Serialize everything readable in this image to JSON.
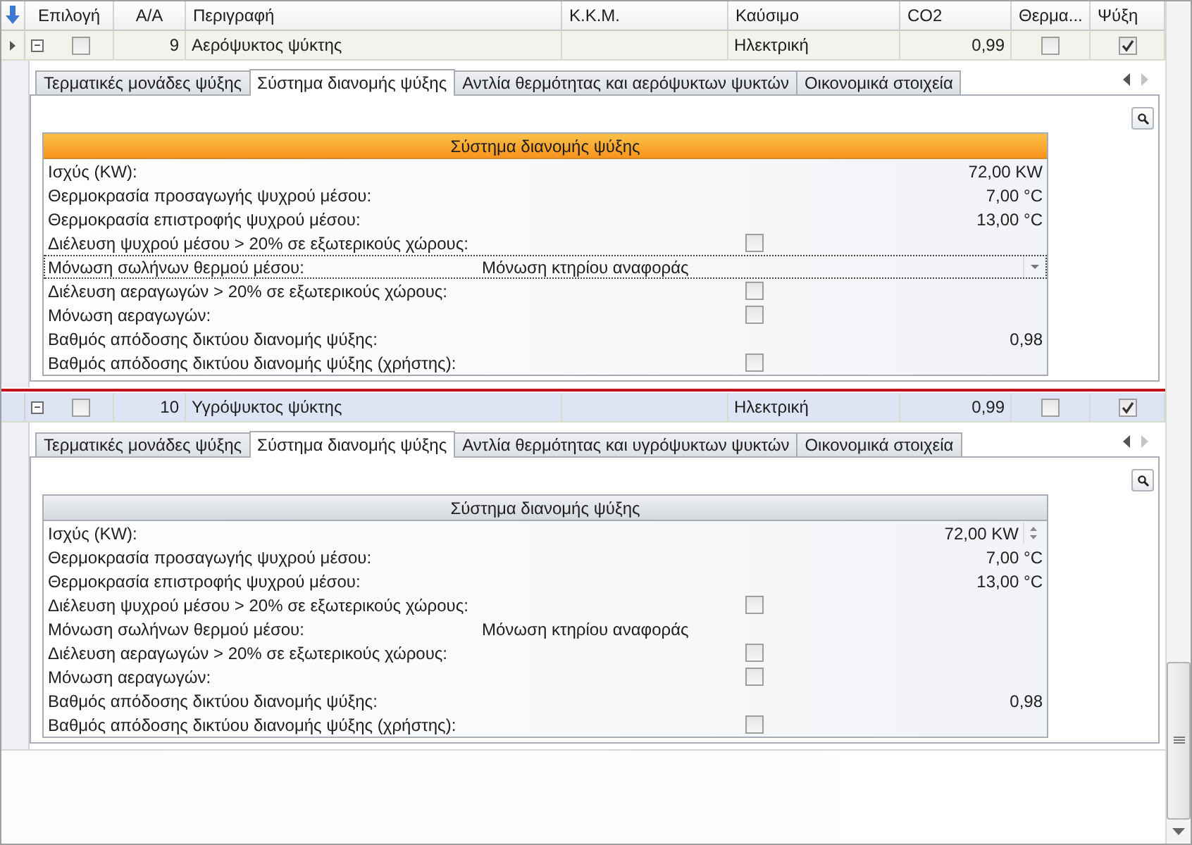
{
  "grid": {
    "columns": [
      "Επιλογή",
      "Α/Α",
      "Περιγραφή",
      "Κ.Κ.Μ.",
      "Καύσιμο",
      "CO2",
      "Θερμα...",
      "Ψύξη"
    ],
    "rows": [
      {
        "focused": true,
        "selected": false,
        "expanded": true,
        "checked": false,
        "number": "9",
        "description": "Αερόψυκτος ψύκτης",
        "fuel": "Ηλεκτρική",
        "co2": "0,99",
        "heating": false,
        "cooling": true,
        "detail": {
          "tabs": [
            {
              "label": "Τερματικές μονάδες ψύξης",
              "selected": false
            },
            {
              "label": "Σύστημα διανομής ψύξης",
              "selected": true
            },
            {
              "label": "Αντλία θερμότητας και αερόψυκτων ψυκτών",
              "selected": false
            },
            {
              "label": "Οικονομικά στοιχεία",
              "selected": false
            }
          ],
          "group": {
            "title": "Σύστημα διανομής ψύξης",
            "active": true
          },
          "fields": [
            {
              "label": "Ισχύς (KW):",
              "kind": "value",
              "value": "72,00 KW"
            },
            {
              "label": "Θερμοκρασία προσαγωγής ψυχρού μέσου:",
              "kind": "value",
              "value": "7,00 °C"
            },
            {
              "label": "Θερμοκρασία επιστροφής ψυχρού μέσου:",
              "kind": "value",
              "value": "13,00 °C"
            },
            {
              "label": "Διέλευση ψυχρού μέσου > 20% σε εξωτερικούς χώρους:",
              "kind": "checkbox",
              "checked": false
            },
            {
              "label": "Μόνωση σωλήνων θερμού μέσου:",
              "kind": "dropdown",
              "value": "Μόνωση κτηρίου αναφοράς"
            },
            {
              "label": "Διέλευση αεραγωγών > 20% σε εξωτερικούς χώρους:",
              "kind": "checkbox",
              "checked": false
            },
            {
              "label": "Μόνωση αεραγωγών:",
              "kind": "checkbox",
              "checked": false
            },
            {
              "label": "Βαθμός απόδοσης δικτύου διανομής ψύξης:",
              "kind": "value",
              "value": "0,98"
            },
            {
              "label": "Βαθμός απόδοσης δικτύου διανομής ψύξης (χρήστης):",
              "kind": "checkbox",
              "checked": false
            }
          ]
        }
      },
      {
        "focused": false,
        "selected": true,
        "expanded": true,
        "checked": false,
        "number": "10",
        "description": "Υγρόψυκτος ψύκτης",
        "fuel": "Ηλεκτρική",
        "co2": "0,99",
        "heating": false,
        "cooling": true,
        "detail": {
          "tabs": [
            {
              "label": "Τερματικές μονάδες ψύξης",
              "selected": false
            },
            {
              "label": "Σύστημα διανομής ψύξης",
              "selected": true
            },
            {
              "label": "Αντλία θερμότητας και υγρόψυκτων ψυκτών",
              "selected": false
            },
            {
              "label": "Οικονομικά στοιχεία",
              "selected": false
            }
          ],
          "group": {
            "title": "Σύστημα διανομής ψύξης",
            "active": false
          },
          "fields": [
            {
              "label": "Ισχύς (KW):",
              "kind": "spin",
              "value": "72,00 KW"
            },
            {
              "label": "Θερμοκρασία προσαγωγής ψυχρού μέσου:",
              "kind": "value",
              "value": "7,00 °C"
            },
            {
              "label": "Θερμοκρασία επιστροφής ψυχρού μέσου:",
              "kind": "value",
              "value": "13,00 °C"
            },
            {
              "label": "Διέλευση ψυχρού μέσου > 20% σε εξωτερικούς χώρους:",
              "kind": "checkbox",
              "checked": false
            },
            {
              "label": "Μόνωση σωλήνων θερμού μέσου:",
              "kind": "text",
              "value": "Μόνωση κτηρίου αναφοράς"
            },
            {
              "label": "Διέλευση αεραγωγών > 20% σε εξωτερικούς χώρους:",
              "kind": "checkbox",
              "checked": false
            },
            {
              "label": "Μόνωση αεραγωγών:",
              "kind": "checkbox",
              "checked": false
            },
            {
              "label": "Βαθμός απόδοσης δικτύου διανομής ψύξης:",
              "kind": "value",
              "value": "0,98"
            },
            {
              "label": "Βαθμός απόδοσης δικτύου διανομής ψύξης (χρήστης):",
              "kind": "checkbox",
              "checked": false
            }
          ]
        }
      }
    ]
  }
}
